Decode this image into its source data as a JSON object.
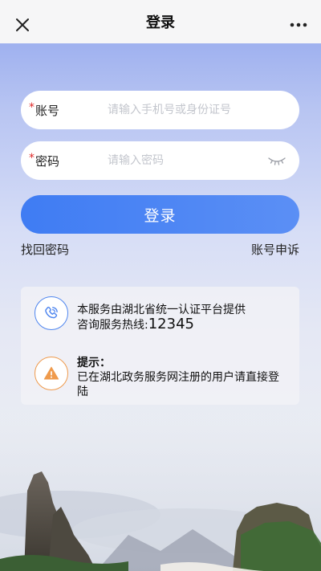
{
  "header": {
    "title": "登录",
    "close_icon": "close-icon",
    "more_icon": "more-icon"
  },
  "form": {
    "account": {
      "required_mark": "*",
      "label": "账号",
      "placeholder": "请输入手机号或身份证号",
      "value": ""
    },
    "password": {
      "required_mark": "*",
      "label": "密码",
      "placeholder": "请输入密码",
      "value": "",
      "toggle_icon": "eye-closed-icon"
    },
    "login_label": "登录"
  },
  "links": {
    "recover_password": "找回密码",
    "account_appeal": "账号申诉"
  },
  "info": {
    "service_line": "本服务由湖北省统一认证平台提供",
    "hotline_label": "咨询服务热线:",
    "hotline_number": "12345",
    "tip_title": "提示：",
    "tip_line1": "已在湖北政务服务网注册的用户请直接登",
    "tip_line2": "陆",
    "phone_icon": "phone-icon",
    "warning_icon": "warning-icon"
  },
  "colors": {
    "primary": "#4a85f3",
    "required": "#e02a2a",
    "warning": "#ef9a4c"
  }
}
